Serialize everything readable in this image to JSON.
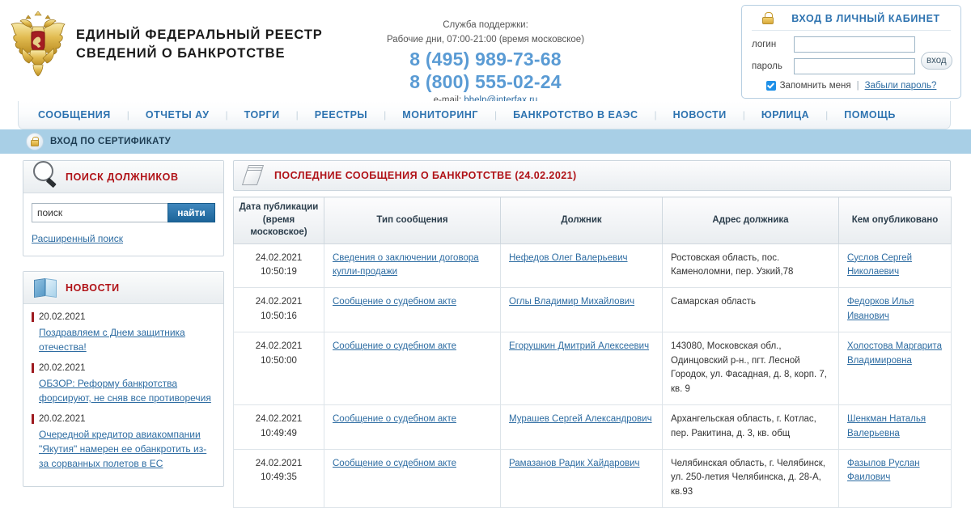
{
  "header": {
    "emblem_alt": "russian-coat-of-arms",
    "title_line1": "ЕДИНЫЙ  ФЕДЕРАЛЬНЫЙ  РЕЕСТР",
    "title_line2": "СВЕДЕНИЙ О БАНКРОТСТВЕ",
    "support": {
      "label": "Служба поддержки:",
      "hours": "Рабочие дни, 07:00-21:00 (время московское)",
      "phone1": "8 (495) 989-73-68",
      "phone2": "8 (800) 555-02-24",
      "email_label": "e-mail:",
      "email": "bhelp@interfax.ru"
    }
  },
  "login": {
    "title": "ВХОД В ЛИЧНЫЙ КАБИНЕТ",
    "login_label": "логин",
    "login_value": "",
    "password_label": "пароль",
    "password_value": "",
    "submit_label": "вход",
    "remember_label": "Запомнить меня",
    "separator": "|",
    "forgot_label": "Забыли пароль?"
  },
  "nav": {
    "items": [
      "СООБЩЕНИЯ",
      "ОТЧЕТЫ АУ",
      "ТОРГИ",
      "РЕЕСТРЫ",
      "МОНИТОРИНГ",
      "БАНКРОТСТВО В ЕАЭС",
      "НОВОСТИ",
      "ЮРЛИЦА",
      "ПОМОЩЬ"
    ],
    "divider": "|"
  },
  "cert_bar": {
    "label": "ВХОД ПО СЕРТИФИКАТУ"
  },
  "search_panel": {
    "title": "ПОИСК ДОЛЖНИКОВ",
    "input_value": "поиск",
    "input_placeholder": "поиск",
    "button_label": "найти",
    "advanced_link": "Расширенный поиск"
  },
  "news_panel": {
    "title": "НОВОСТИ",
    "items": [
      {
        "date": "20.02.2021",
        "text": "Поздравляем с Днем защитника отечества!"
      },
      {
        "date": "20.02.2021",
        "text": "ОБЗОР: Реформу банкротства форсируют, не сняв все противоречия"
      },
      {
        "date": "20.02.2021",
        "text": "Очередной кредитор авиакомпании \"Якутия\" намерен ее обанкротить из-за сорванных полетов в ЕС"
      }
    ]
  },
  "messages_panel": {
    "title": "ПОСЛЕДНИЕ СООБЩЕНИЯ О БАНКРОТСТВЕ (24.02.2021)",
    "columns": [
      "Дата публикации (время московское)",
      "Тип сообщения",
      "Должник",
      "Адрес должника",
      "Кем опубликовано"
    ],
    "col_date_line1": "Дата публикации",
    "col_date_line2": "(время московское)",
    "rows": [
      {
        "date": "24.02.2021",
        "time": "10:50:19",
        "type": "Сведения о заключении договора купли-продажи",
        "debtor": "Нефедов Олег Валерьевич",
        "address": "Ростовская область, пос. Каменоломни, пер. Узкий,78",
        "published_by": "Суслов Сергей Николаевич"
      },
      {
        "date": "24.02.2021",
        "time": "10:50:16",
        "type": "Сообщение о судебном акте",
        "debtor": "Оглы Владимир Михайлович",
        "address": "Самарская область",
        "published_by": "Федорков Илья Иванович"
      },
      {
        "date": "24.02.2021",
        "time": "10:50:00",
        "type": "Сообщение о судебном акте",
        "debtor": "Егорушкин Дмитрий Алексеевич",
        "address": "143080, Московская обл., Одинцовский р-н., пгт. Лесной Городок, ул. Фасадная, д. 8, корп. 7, кв. 9",
        "published_by": "Холостова Маргарита Владимировна"
      },
      {
        "date": "24.02.2021",
        "time": "10:49:49",
        "type": "Сообщение о судебном акте",
        "debtor": "Мурашев Сергей Александрович",
        "address": "Архангельская область, г. Котлас, пер. Ракитина, д. 3, кв. общ",
        "published_by": "Шенкман Наталья Валерьевна"
      },
      {
        "date": "24.02.2021",
        "time": "10:49:35",
        "type": "Сообщение о судебном акте",
        "debtor": "Рамазанов Радик Хайдарович",
        "address": "Челябинская область, г. Челябинск, ул. 250-летия Челябинска, д. 28-А, кв.93",
        "published_by": "Фазылов Руслан Фаилович"
      }
    ]
  },
  "colors": {
    "accent_blue": "#2e73b0",
    "phone_blue": "#5a9bd4",
    "band_blue": "#a8cfe6",
    "title_red": "#b01217",
    "news_mark_red": "#9e1b20",
    "search_button": "#1c6499"
  }
}
